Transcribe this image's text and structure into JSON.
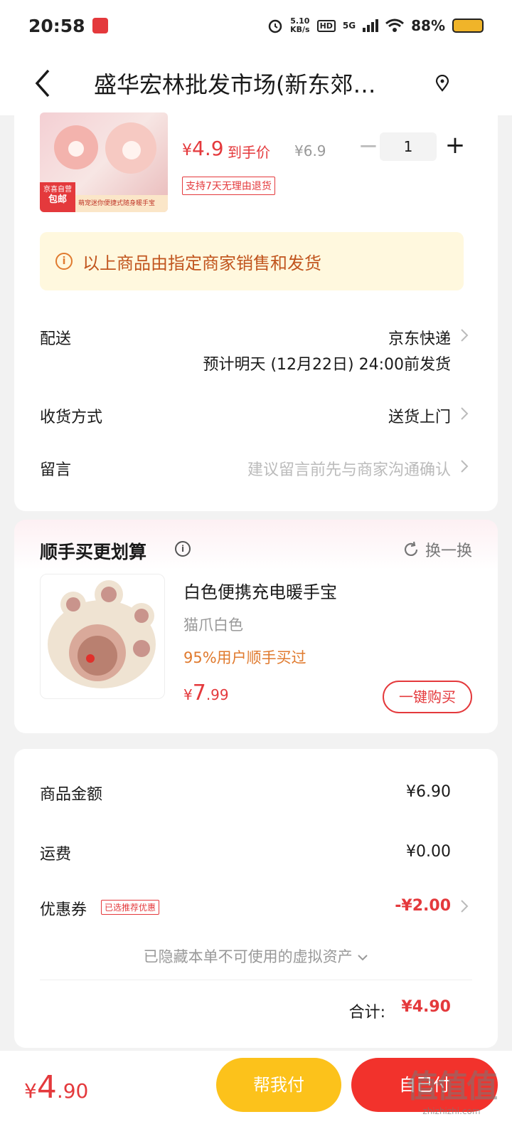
{
  "status_bar": {
    "time": "20:58",
    "net_speed_value": "5.10",
    "net_speed_unit": "KB/s",
    "hd": "HD",
    "signal_label": "5G",
    "battery_pct": "88%"
  },
  "nav": {
    "title": "盛华宏林批发市场(新东郊…"
  },
  "product": {
    "img_tag_top": "京喜自营",
    "img_tag_main": "包邮",
    "img_banner": "萌宠迷你便捷式随身暖手宝",
    "currency": "¥",
    "price": "4.9",
    "price_label": "到手价",
    "original_price": "¥6.9",
    "minus": "−",
    "quantity": "1",
    "plus": "+",
    "return_policy": "支持7天无理由退货"
  },
  "notice": {
    "icon": "i",
    "text": "以上商品由指定商家销售和发货"
  },
  "delivery": {
    "label": "配送",
    "carrier": "京东快递",
    "estimate": "预计明天 (12月22日) 24:00前发货"
  },
  "receive_method": {
    "label": "收货方式",
    "value": "送货上门"
  },
  "message": {
    "label": "留言",
    "placeholder": "建议留言前先与商家沟通确认"
  },
  "recommend": {
    "title": "顺手买更划算",
    "info_icon": "i",
    "swap_label": "换一换",
    "name": "白色便携充电暖手宝",
    "spec": "猫爪白色",
    "popularity": "95%用户顺手买过",
    "currency": "¥",
    "price_int": "7",
    "price_dec": ".99",
    "buy_label": "一键购买"
  },
  "summary": {
    "goods_label": "商品金额",
    "goods_value": "¥6.90",
    "shipping_label": "运费",
    "shipping_value": "¥0.00",
    "coupon_label": "优惠券",
    "coupon_tag": "已选推荐优惠",
    "coupon_value": "-¥2.00",
    "hidden_assets": "已隐藏本单不可使用的虚拟资产",
    "total_label": "合计:",
    "total_value": "¥4.90"
  },
  "bottom": {
    "currency": "¥",
    "price_int": "4",
    "price_dec": ".90",
    "help_pay": "帮我付",
    "submit": "自己付",
    "watermark": "值值值",
    "watermark_sub": "zhizhizhi.com"
  },
  "colors": {
    "accent_red": "#e4393c",
    "help_pay_yellow": "#fcc21b",
    "notice_bg": "#fff8de",
    "notice_text": "#c1551e",
    "popular_orange": "#e07a2e"
  }
}
